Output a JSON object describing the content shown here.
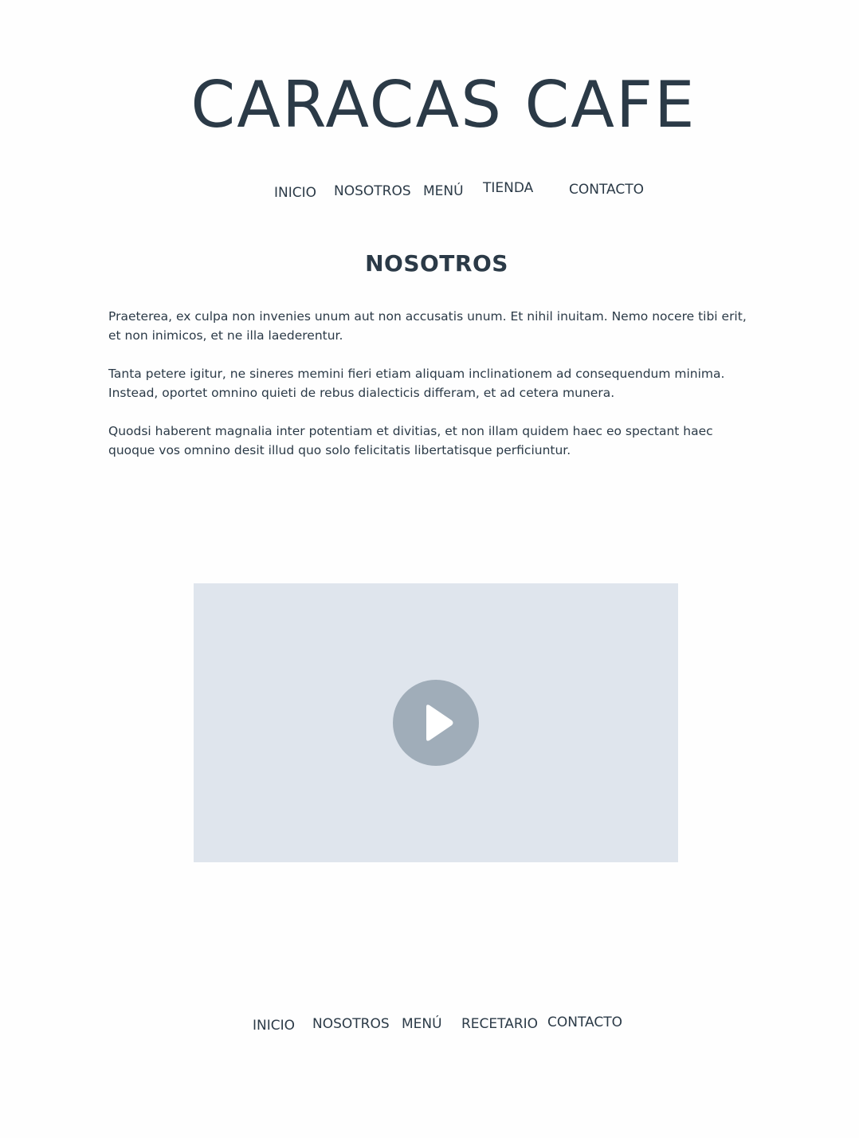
{
  "site": {
    "title": "CARACAS CAFE"
  },
  "header_nav": {
    "items": [
      {
        "label": "INICIO"
      },
      {
        "label": "NOSOTROS"
      },
      {
        "label": "MENÚ"
      },
      {
        "label": "TIENDA"
      },
      {
        "label": "CONTACTO"
      }
    ]
  },
  "main": {
    "title": "NOSOTROS",
    "paragraphs": [
      "Praeterea, ex culpa non invenies unum aut non accusatis unum. Et nihil inuitam. Nemo nocere tibi erit, et non inimicos, et ne illa laederentur.",
      "Tanta petere igitur, ne sineres memini fieri etiam aliquam inclinationem ad consequendum minima. Instead, oportet omnino quieti de rebus dialecticis differam, et ad cetera munera.",
      "Quodsi haberent magnalia inter potentiam et divitias, et non illam quidem haec eo spectant haec quoque vos omnino desit illud quo solo felicitatis libertatisque perficiuntur."
    ]
  },
  "video": {
    "icon": "play-icon",
    "background_color": "#dfe5ed",
    "button_color": "#a0adb9"
  },
  "footer_nav": {
    "items": [
      {
        "label": "INICIO"
      },
      {
        "label": "NOSOTROS"
      },
      {
        "label": "MENÚ"
      },
      {
        "label": "RECETARIO"
      },
      {
        "label": "CONTACTO"
      }
    ]
  },
  "colors": {
    "text": "#2b3a47",
    "background": "#fefefe"
  }
}
